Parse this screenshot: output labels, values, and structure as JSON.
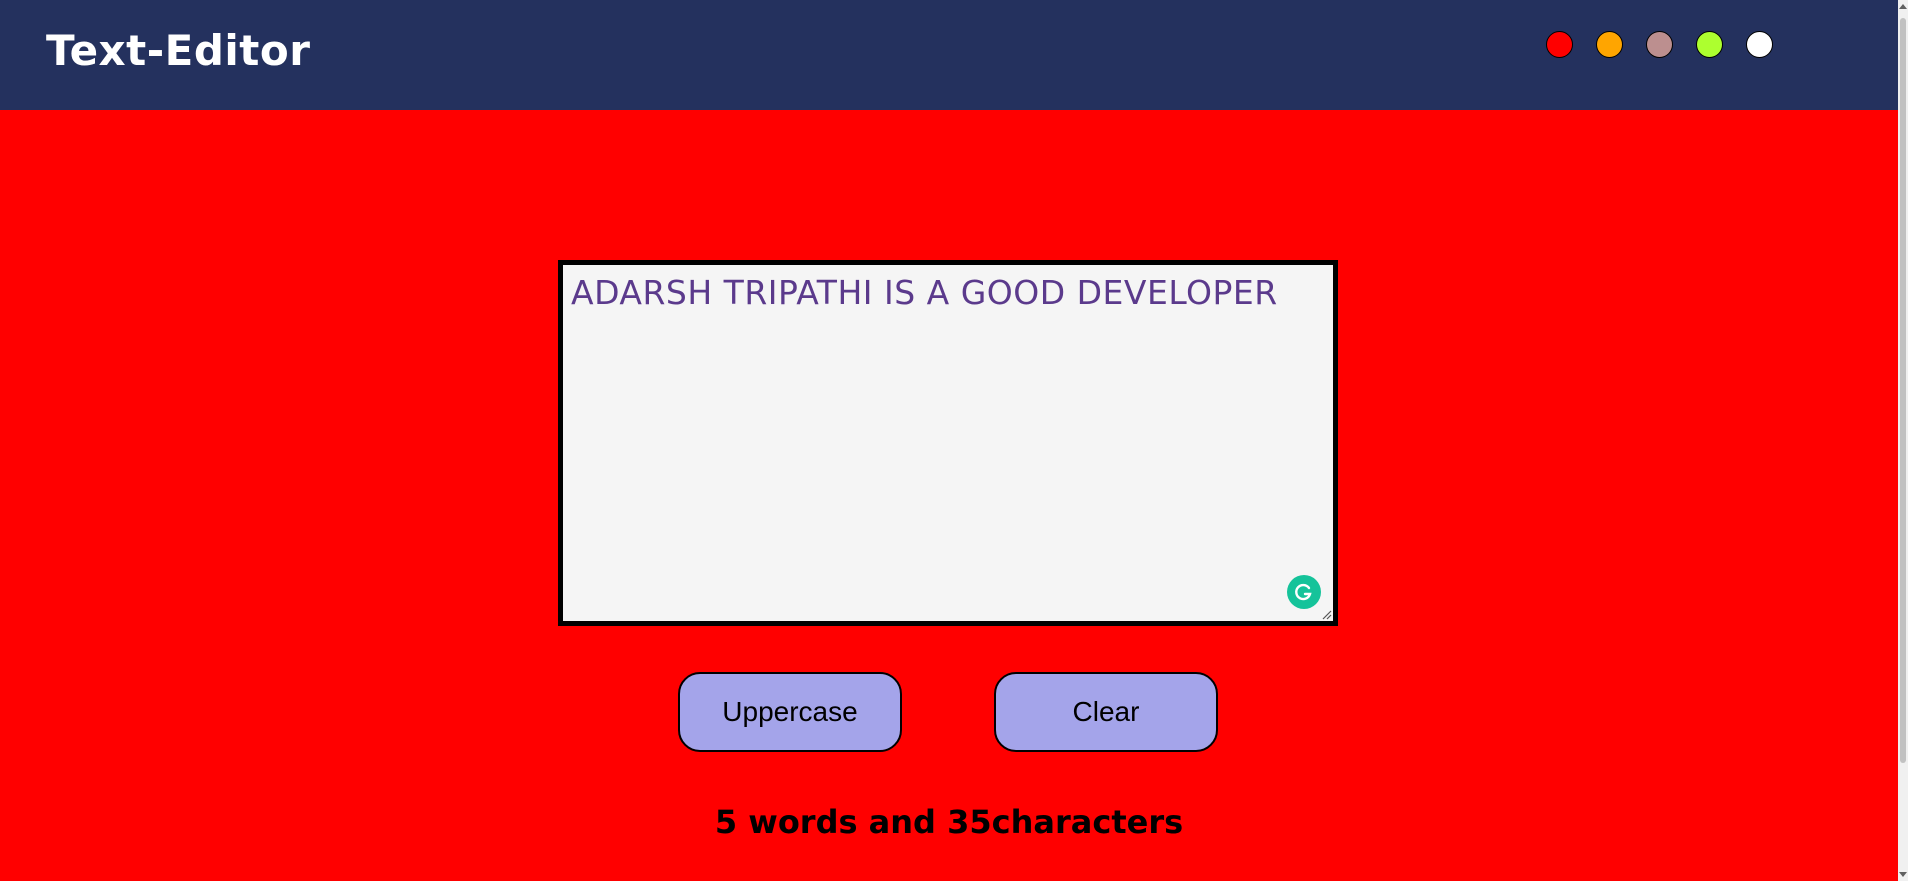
{
  "navbar": {
    "brand": "Text-Editor",
    "swatches": [
      {
        "name": "red",
        "color": "#ff0000"
      },
      {
        "name": "orange",
        "color": "#ffa500"
      },
      {
        "name": "rosybrown",
        "color": "#bc8f8f"
      },
      {
        "name": "greenyellow",
        "color": "#adff2f"
      },
      {
        "name": "white",
        "color": "#ffffff"
      }
    ],
    "background": "#24315e"
  },
  "main": {
    "background": "#ff0000",
    "editor": {
      "value": "ADARSH TRIPATHI IS A GOOD DEVELOPER",
      "text_color": "#5b3a8c",
      "grammarly_icon": "grammarly-icon"
    },
    "buttons": {
      "uppercase_label": "Uppercase",
      "clear_label": "Clear",
      "color": "#a4a4ea"
    },
    "status": "5 words and 35characters"
  }
}
